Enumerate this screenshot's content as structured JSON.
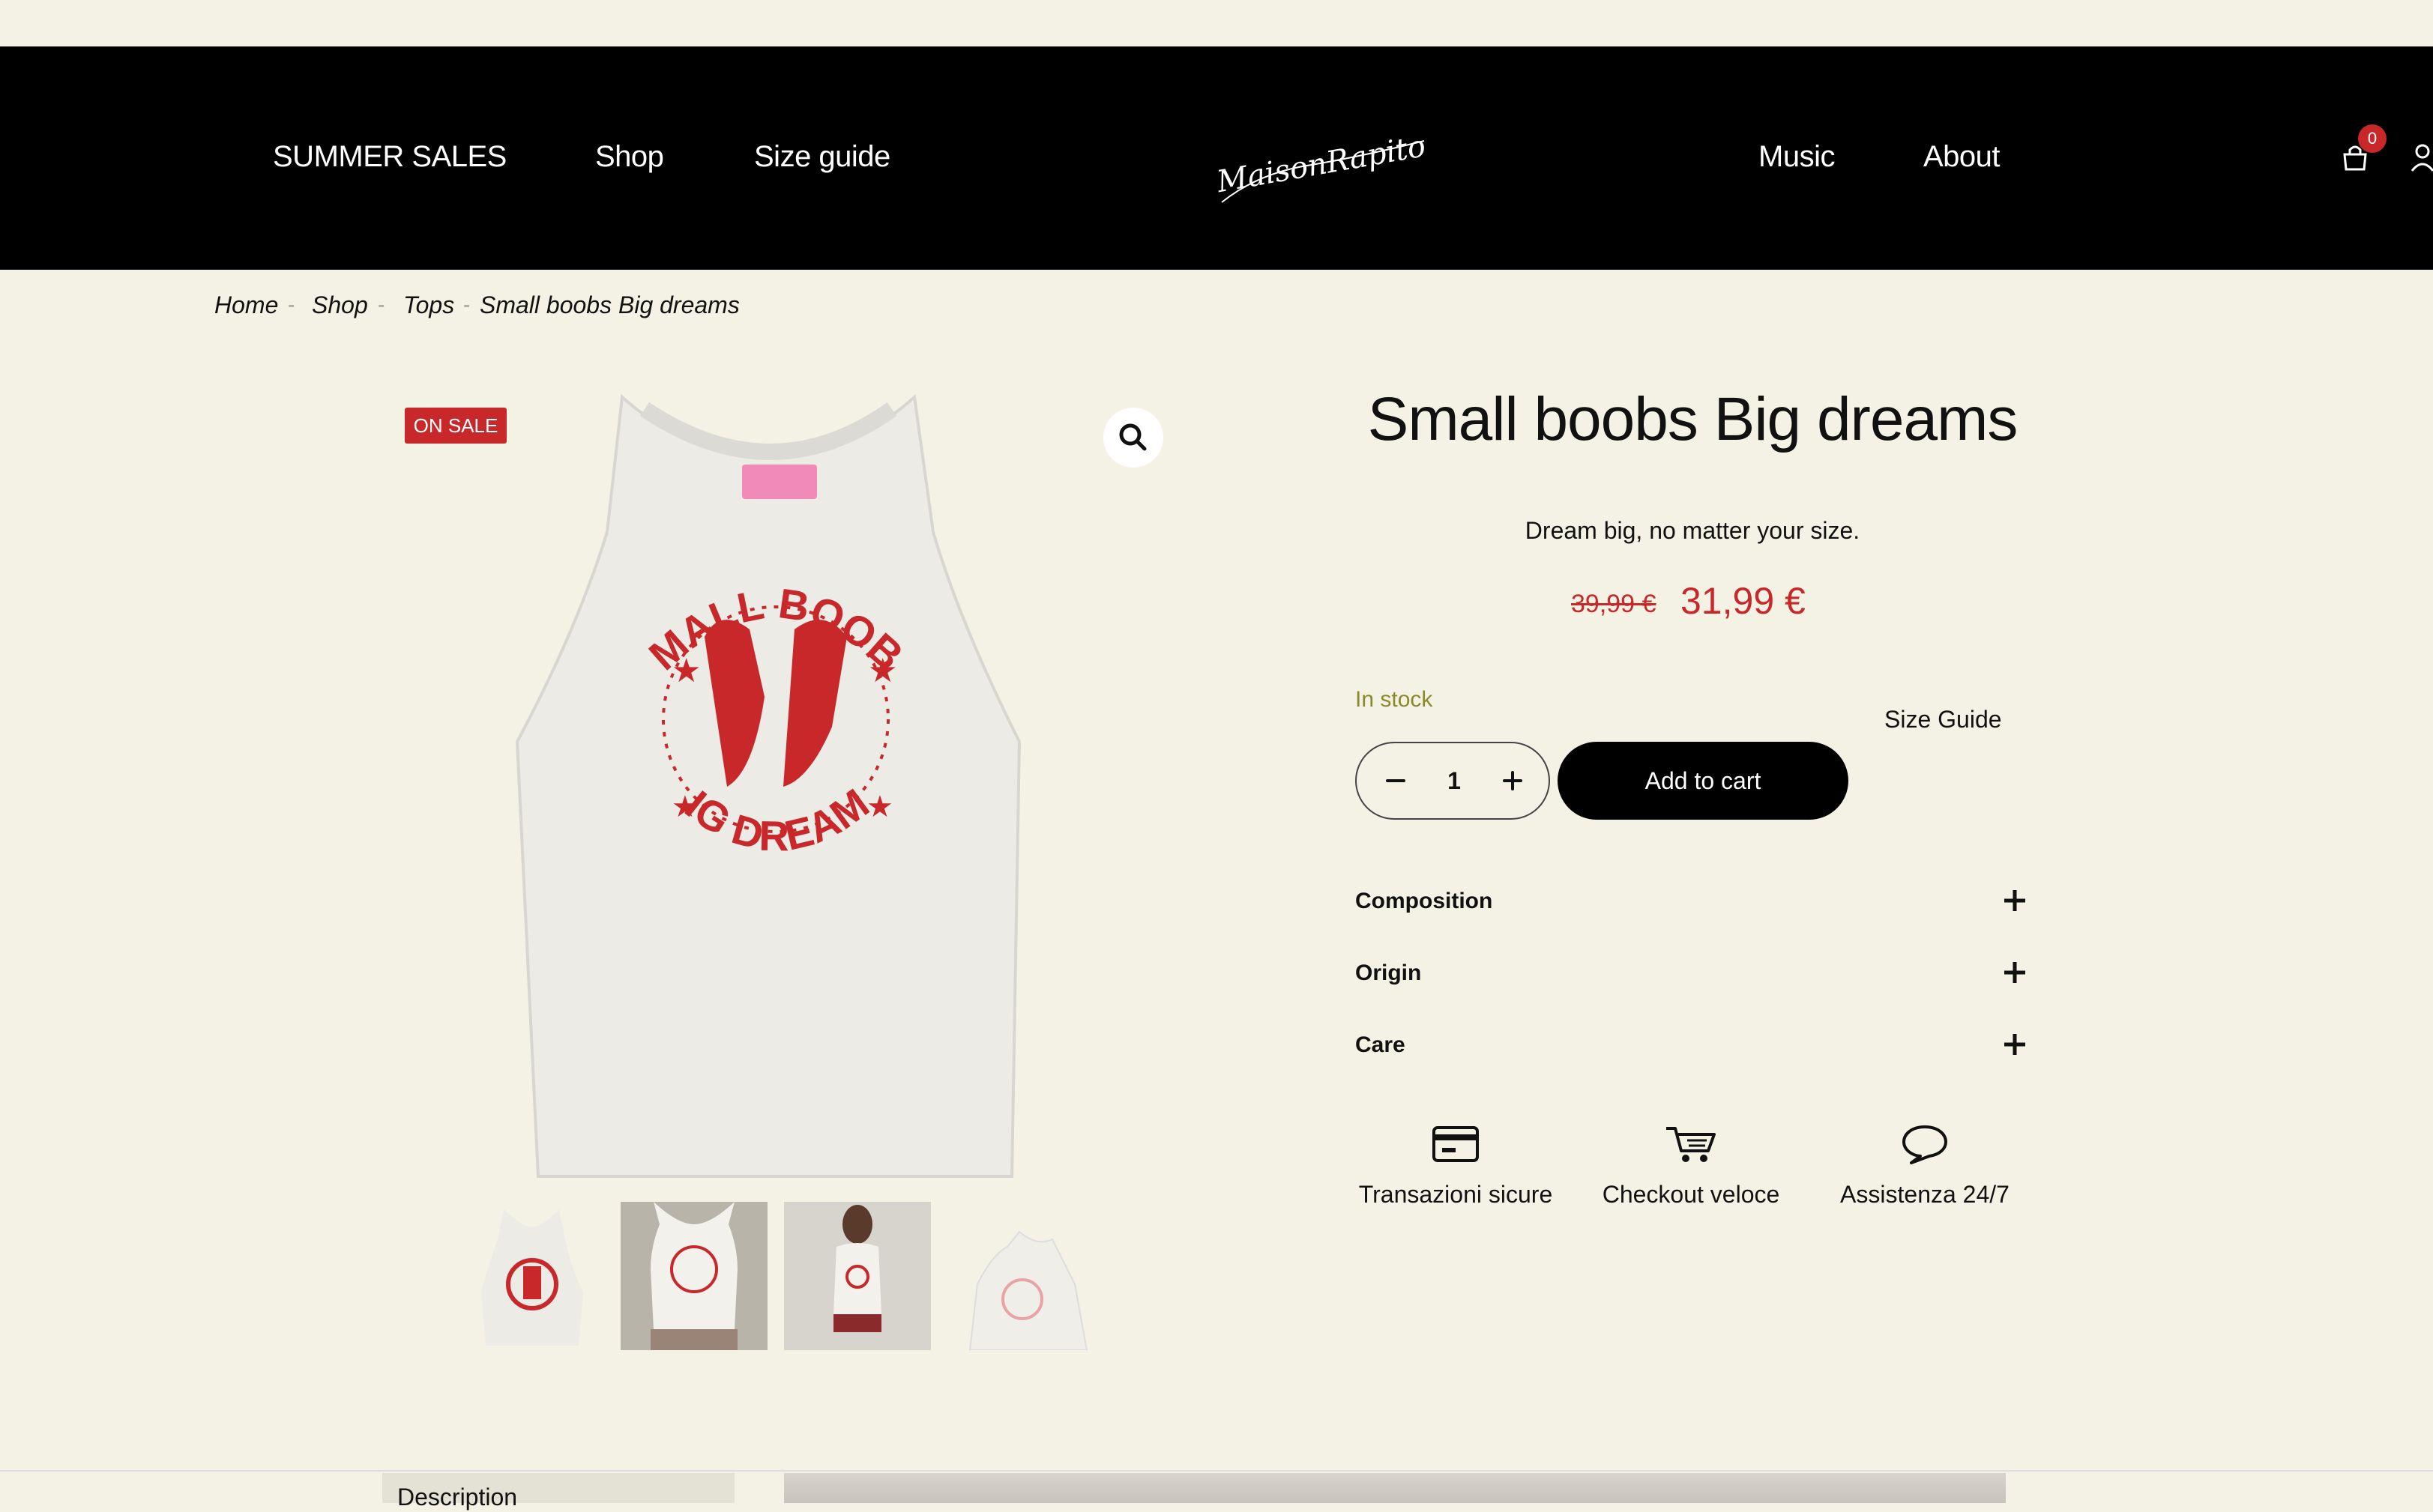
{
  "header": {
    "nav_left": [
      "SUMMER SALES",
      "Shop",
      "Size guide"
    ],
    "nav_right": [
      "Music",
      "About"
    ],
    "logo_text": "MaisonRapito",
    "cart_count": "0"
  },
  "breadcrumb": [
    "Home",
    "Shop",
    "Tops",
    "Small boobs Big dreams"
  ],
  "gallery": {
    "badge": "ON SALE",
    "print_top": "SMALL BOOBS",
    "print_bottom": "BIG DREAMS"
  },
  "product": {
    "title": "Small boobs Big dreams",
    "tagline": "Dream big, no matter your size.",
    "old_price": "39,99 €",
    "price": "31,99 €",
    "stock": "In stock",
    "size_guide": "Size Guide",
    "quantity": "1",
    "add_to_cart": "Add to cart",
    "accordion": [
      "Composition",
      "Origin",
      "Care"
    ]
  },
  "features": [
    "Transazioni sicure",
    "Checkout veloce",
    "Assistenza 24/7"
  ],
  "tabs": {
    "description": "Description"
  },
  "colors": {
    "accent": "#c8282a",
    "background": "#f4f2e4",
    "header": "#000000",
    "stock": "#8a8a2a"
  }
}
